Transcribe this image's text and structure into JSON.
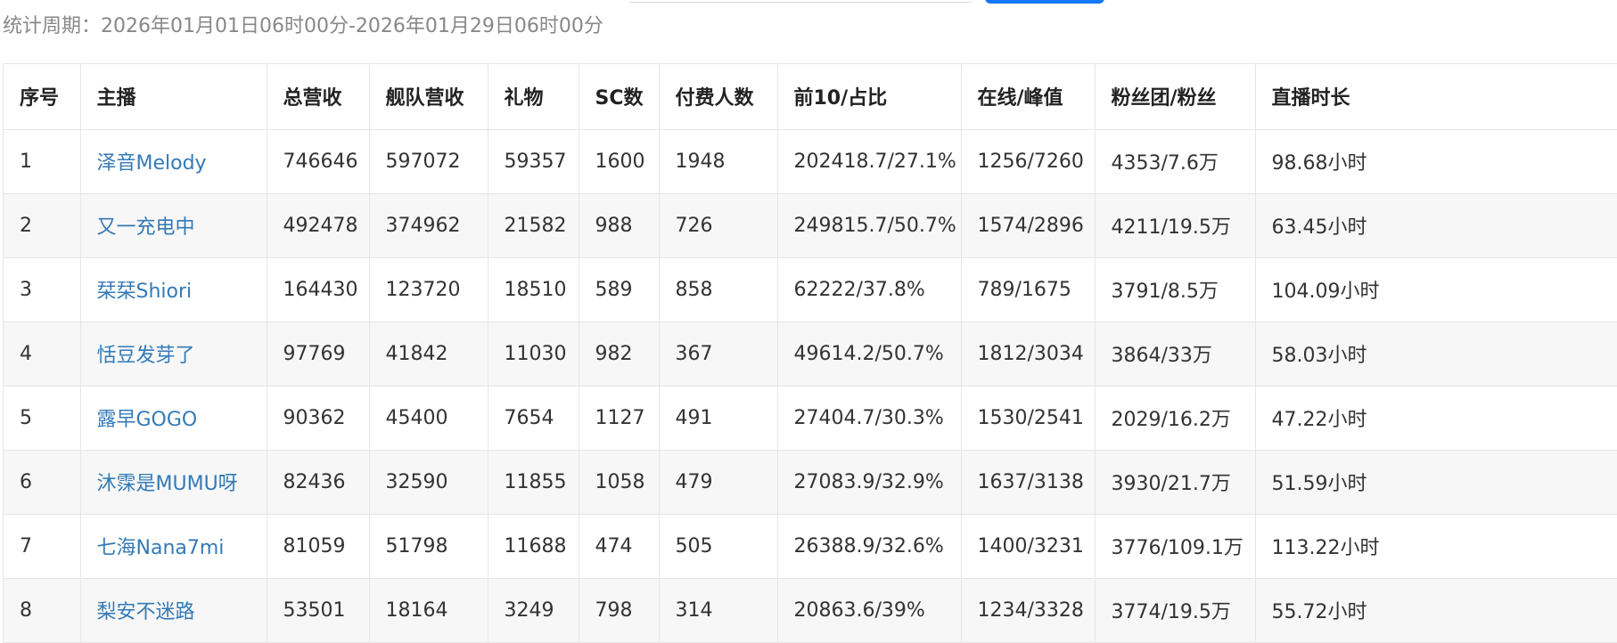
{
  "header": {
    "period_label": "统计周期：",
    "period_value": "2026年01月01日06时00分-2026年01月29日06时00分"
  },
  "table": {
    "columns": [
      "序号",
      "主播",
      "总营收",
      "舰队营收",
      "礼物",
      "SC数",
      "付费人数",
      "前10/占比",
      "在线/峰值",
      "粉丝团/粉丝",
      "直播时长"
    ],
    "rows": [
      [
        "1",
        "泽音Melody",
        "746646",
        "597072",
        "59357",
        "1600",
        "1948",
        "202418.7/27.1%",
        "1256/7260",
        "4353/7.6万",
        "98.68小时"
      ],
      [
        "2",
        "又一充电中",
        "492478",
        "374962",
        "21582",
        "988",
        "726",
        "249815.7/50.7%",
        "1574/2896",
        "4211/19.5万",
        "63.45小时"
      ],
      [
        "3",
        "栞栞Shiori",
        "164430",
        "123720",
        "18510",
        "589",
        "858",
        "62222/37.8%",
        "789/1675",
        "3791/8.5万",
        "104.09小时"
      ],
      [
        "4",
        "恬豆发芽了",
        "97769",
        "41842",
        "11030",
        "982",
        "367",
        "49614.2/50.7%",
        "1812/3034",
        "3864/33万",
        "58.03小时"
      ],
      [
        "5",
        "露早GOGO",
        "90362",
        "45400",
        "7654",
        "1127",
        "491",
        "27404.7/30.3%",
        "1530/2541",
        "2029/16.2万",
        "47.22小时"
      ],
      [
        "6",
        "沐霂是MUMU呀",
        "82436",
        "32590",
        "11855",
        "1058",
        "479",
        "27083.9/32.9%",
        "1637/3138",
        "3930/21.7万",
        "51.59小时"
      ],
      [
        "7",
        "七海Nana7mi",
        "81059",
        "51798",
        "11688",
        "474",
        "505",
        "26388.9/32.6%",
        "1400/3231",
        "3776/109.1万",
        "113.22小时"
      ],
      [
        "8",
        "梨安不迷路",
        "53501",
        "18164",
        "3249",
        "798",
        "314",
        "20863.6/39%",
        "1234/3328",
        "3774/19.5万",
        "55.72小时"
      ]
    ]
  },
  "colors": {
    "link": "#337ab7",
    "primary_button": "#1677ff",
    "stripe": "#f7f7f7",
    "border": "#e6e6e6",
    "muted_text": "#888888"
  }
}
